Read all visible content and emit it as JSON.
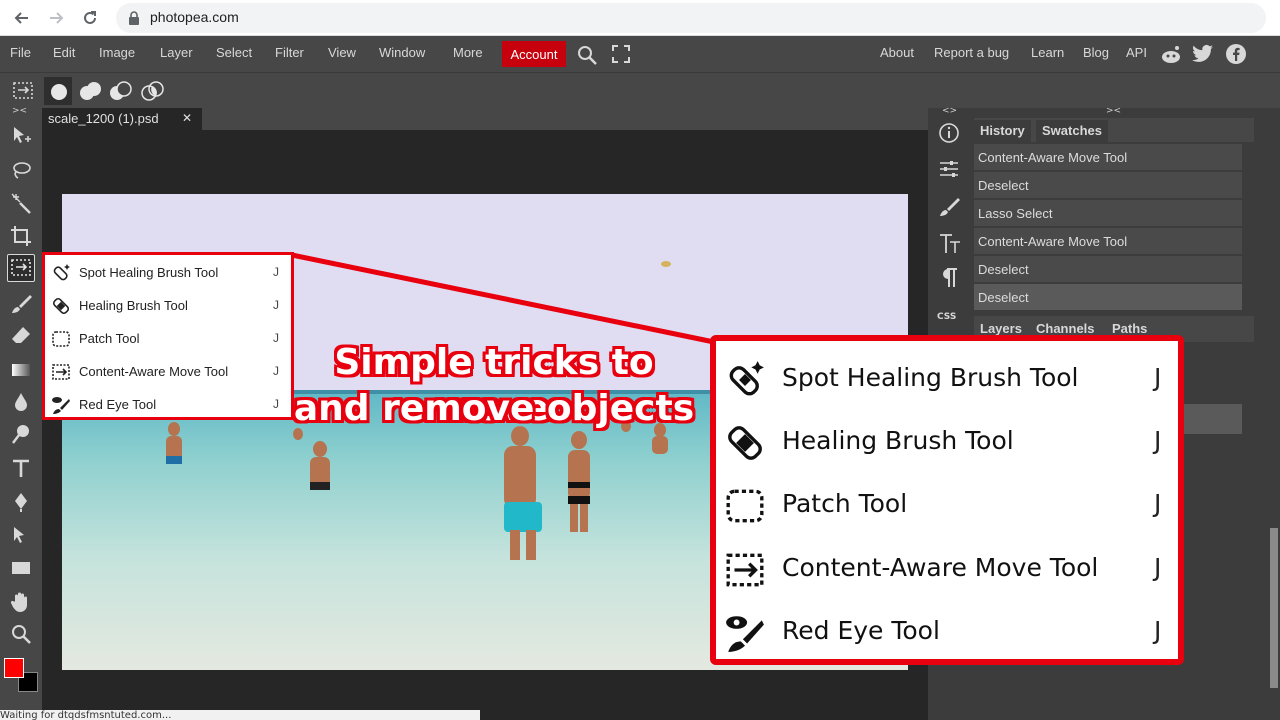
{
  "browser": {
    "url": "photopea.com"
  },
  "menu": {
    "items": [
      "File",
      "Edit",
      "Image",
      "Layer",
      "Select",
      "Filter",
      "View",
      "Window",
      "More"
    ],
    "account": "Account",
    "right_links": [
      "About",
      "Report a bug",
      "Learn",
      "Blog",
      "API"
    ]
  },
  "document": {
    "tab_title": "scale_1200 (1).psd",
    "close_glyph": "✕"
  },
  "panels": {
    "collapse_glyph_left": "<>",
    "collapse_glyph_right": "><",
    "history_tab": "History",
    "swatches_tab": "Swatches",
    "history_items": [
      "Content-Aware Move Tool",
      "Deselect",
      "Lasso Select",
      "Content-Aware Move Tool",
      "Deselect",
      "Deselect"
    ],
    "layers_tab": "Layers",
    "channels_tab": "Channels",
    "paths_tab": "Paths",
    "css_label": "CSS"
  },
  "tool_menu": {
    "items": [
      {
        "label": "Spot Healing Brush Tool",
        "key": "J",
        "icon": "spot-healing-icon"
      },
      {
        "label": "Healing Brush Tool",
        "key": "J",
        "icon": "bandage-icon"
      },
      {
        "label": "Patch Tool",
        "key": "J",
        "icon": "patch-icon"
      },
      {
        "label": "Content-Aware Move Tool",
        "key": "J",
        "icon": "content-aware-move-icon"
      },
      {
        "label": "Red Eye Tool",
        "key": "J",
        "icon": "red-eye-icon"
      }
    ]
  },
  "overlay": {
    "headline_line1": "Simple tricks to move",
    "headline_line2": "and remove objects"
  },
  "status": {
    "text": "Waiting for dtqdsfmsntuted.com..."
  },
  "colors": {
    "accent": "#e8000f",
    "account": "#c7000d",
    "foreground_swatch": "#ff0000",
    "background_swatch": "#000000"
  }
}
